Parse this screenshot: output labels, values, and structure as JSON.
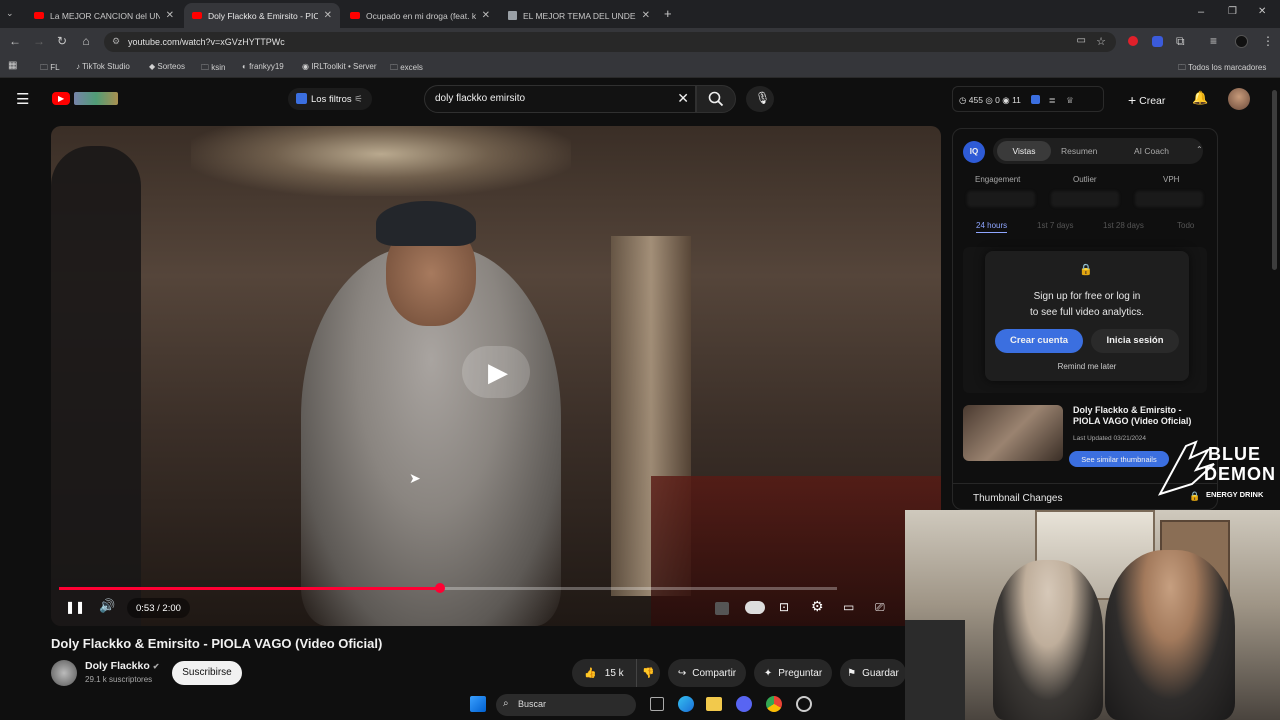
{
  "tabs": [
    {
      "title": "La MEJOR CANCION del UNDER"
    },
    {
      "title": "Doly Flackko & Emirsito - PIOLA"
    },
    {
      "title": "Ocupado en mi droga (feat. ki"
    },
    {
      "title": "EL MEJOR TEMA DEL UNDER B"
    }
  ],
  "browser": {
    "url": "youtube.com/watch?v=xGVzHYTTPWc",
    "bookmarks": [
      "FL",
      "TikTok Studio",
      "Sorteos",
      "ksin",
      "frankyy19",
      "IRLToolkit • Server",
      "excels"
    ],
    "all_bookmarks": "Todos los marcadores"
  },
  "youtube": {
    "filters_label": "Los filtros",
    "search_value": "doly flackko emirsito",
    "stats": {
      "a": "455",
      "b": "0",
      "c": "11"
    },
    "create_label": "Crear"
  },
  "player": {
    "time": "0:53 / 2:00",
    "progress": 0.49
  },
  "video": {
    "title": "Doly Flackko & Emirsito - PIOLA VAGO (Video Oficial)",
    "channel": "Doly Flackko",
    "subscribers": "29.1 k suscriptores",
    "subscribe_label": "Suscribirse",
    "likes": "15 k",
    "share_label": "Compartir",
    "ask_label": "Preguntar",
    "save_label": "Guardar"
  },
  "panel": {
    "tabs": [
      "Vistas",
      "Resumen",
      "AI Coach"
    ],
    "metrics": [
      "Engagement",
      "Outlier",
      "VPH"
    ],
    "ranges": [
      "24 hours",
      "1st 7 days",
      "1st 28 days",
      "Todo"
    ],
    "signup_line1": "Sign up for free or log in",
    "signup_line2": "to see full video analytics.",
    "create_account": "Crear cuenta",
    "login": "Inicia sesión",
    "remind": "Remind me later",
    "thumb_title": "Doly Flackko & Emirsito - PIOLA VAGO (Video Oficial)",
    "last_updated": "Last Updated 03/21/2024",
    "similar": "See similar thumbnails",
    "thumb_changes": "Thumbnail Changes"
  },
  "overlay": {
    "brand1": "BLUE",
    "brand2": "DEMON",
    "brand3": "ENERGY DRINK"
  },
  "taskbar": {
    "search": "Buscar"
  }
}
